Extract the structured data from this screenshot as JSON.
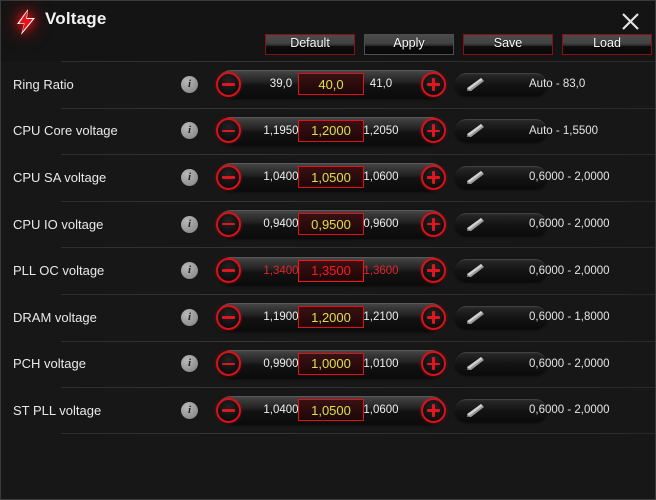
{
  "window": {
    "title": "Voltage",
    "logo_icon": "lightning-bolt-icon",
    "close_icon": "close-icon"
  },
  "toolbar": {
    "buttons": [
      {
        "label": "Default",
        "style": "accent"
      },
      {
        "label": "Apply",
        "style": "neutral"
      },
      {
        "label": "Save",
        "style": "accent"
      },
      {
        "label": "Load",
        "style": "accent"
      }
    ]
  },
  "icons": {
    "info": "info-icon",
    "minus": "minus-icon",
    "plus": "plus-icon",
    "edit": "pencil-icon"
  },
  "colors": {
    "accent_red": "#d8121b",
    "value_yellow": "#d7e24a",
    "alert_red": "#fb1b22",
    "window_bg": "#171717",
    "title_bg": "#141414"
  },
  "rows": [
    {
      "label": "Ring Ratio",
      "prev": "39,0",
      "value": "40,0",
      "next": "41,0",
      "range": "Auto - 83,0",
      "alert": false
    },
    {
      "label": "CPU Core voltage",
      "prev": "1,1950",
      "value": "1,2000",
      "next": "1,2050",
      "range": "Auto - 1,5500",
      "alert": false
    },
    {
      "label": "CPU SA voltage",
      "prev": "1,0400",
      "value": "1,0500",
      "next": "1,0600",
      "range": "0,6000 - 2,0000",
      "alert": false
    },
    {
      "label": "CPU IO voltage",
      "prev": "0,9400",
      "value": "0,9500",
      "next": "0,9600",
      "range": "0,6000 - 2,0000",
      "alert": false
    },
    {
      "label": "PLL OC voltage",
      "prev": "1,3400",
      "value": "1,3500",
      "next": "1,3600",
      "range": "0,6000 - 2,0000",
      "alert": true
    },
    {
      "label": "DRAM voltage",
      "prev": "1,1900",
      "value": "1,2000",
      "next": "1,2100",
      "range": "0,6000 - 1,8000",
      "alert": false
    },
    {
      "label": "PCH voltage",
      "prev": "0,9900",
      "value": "1,0000",
      "next": "1,0100",
      "range": "0,6000 - 2,0000",
      "alert": false
    },
    {
      "label": "ST PLL voltage",
      "prev": "1,0400",
      "value": "1,0500",
      "next": "1,0600",
      "range": "0,6000 - 2,0000",
      "alert": false
    }
  ]
}
